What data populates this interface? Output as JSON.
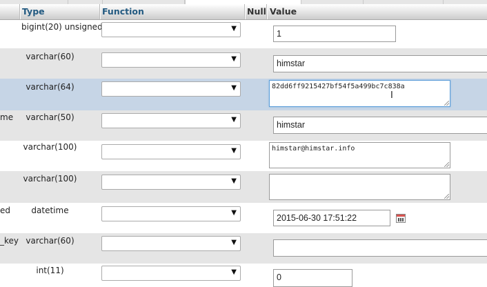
{
  "header": {
    "type_label": "Type",
    "function_label": "Function",
    "null_label": "Null",
    "value_label": "Value"
  },
  "rows": [
    {
      "field": "",
      "type": "bigint(20) unsigned",
      "function": "",
      "value": "1"
    },
    {
      "field": "",
      "type": "varchar(60)",
      "function": "",
      "value": "himstar"
    },
    {
      "field": "",
      "type": "varchar(64)",
      "function": "",
      "value": "82dd6ff9215427bf54f5a499bc7c838a"
    },
    {
      "field": "me",
      "type": "varchar(50)",
      "function": "",
      "value": "himstar"
    },
    {
      "field": "",
      "type": "varchar(100)",
      "function": "",
      "value": "himstar@himstar.info"
    },
    {
      "field": "",
      "type": "varchar(100)",
      "function": "",
      "value": ""
    },
    {
      "field": "ed",
      "type": "datetime",
      "function": "",
      "value": "2015-06-30 17:51:22"
    },
    {
      "field": "_key",
      "type": "varchar(60)",
      "function": "",
      "value": ""
    },
    {
      "field": "",
      "type": "int(11)",
      "function": "",
      "value": "0"
    }
  ],
  "icons": {
    "dropdown": "chevron-down-icon",
    "calendar": "calendar-icon",
    "text_cursor": "text-cursor-icon",
    "resize": "resize-grip-icon"
  },
  "colors": {
    "highlight_row": "#c6d5e6",
    "header_text": "#235a81",
    "focus_border": "#5b9dd9"
  }
}
